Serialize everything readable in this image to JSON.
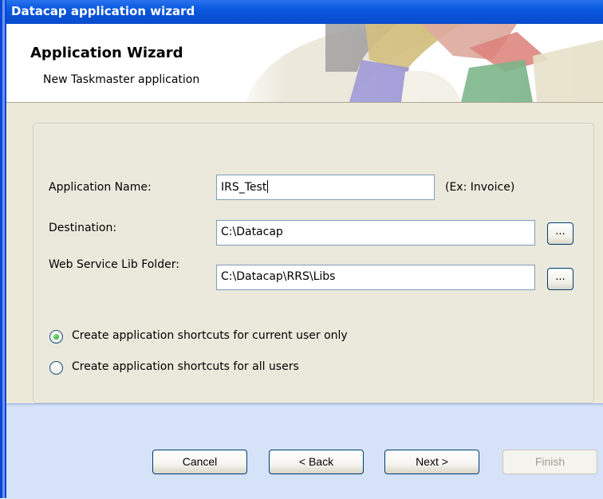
{
  "window": {
    "title": "Datacap application wizard"
  },
  "header": {
    "title": "Application Wizard",
    "subtitle": "New Taskmaster application"
  },
  "form": {
    "app_name_label": "Application Name:",
    "app_name_value": "IRS_Test",
    "app_name_hint": "(Ex: Invoice)",
    "destination_label": "Destination:",
    "destination_value": "C:\\Datacap",
    "webservice_label": "Web Service Lib Folder:",
    "webservice_value": "C:\\Datacap\\RRS\\Libs",
    "browse_label": "...",
    "radio_current_user": "Create application shortcuts for current user only",
    "radio_all_users": "Create application shortcuts for all users",
    "selected_option": "current_user"
  },
  "buttons": {
    "cancel": "Cancel",
    "back": "< Back",
    "next": "Next >",
    "finish": "Finish"
  },
  "colors": {
    "titlebar": "#0a5ae0",
    "body": "#ece9d8",
    "footer": "#d5e2f8"
  }
}
